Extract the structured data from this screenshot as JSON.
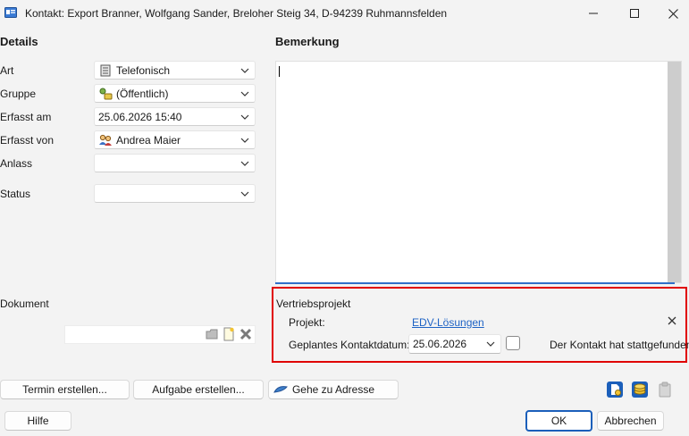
{
  "window": {
    "title": "Kontakt: Export Branner, Wolfgang Sander, Breloher Steig 34, D-94239 Ruhmannsfelden"
  },
  "details": {
    "heading": "Details",
    "fields": {
      "art": {
        "label": "Art",
        "value": "Telefonisch",
        "icon": "phone-list-icon"
      },
      "gruppe": {
        "label": "Gruppe",
        "value": "(Öffentlich)",
        "icon": "group-key-icon"
      },
      "erfasst_am": {
        "label": "Erfasst am",
        "value": "25.06.2026 15:40"
      },
      "erfasst_von": {
        "label": "Erfasst von",
        "value": "Andrea Maier",
        "icon": "users-icon"
      },
      "anlass": {
        "label": "Anlass",
        "value": ""
      },
      "status": {
        "label": "Status",
        "value": ""
      }
    },
    "dokument": {
      "label": "Dokument",
      "value": ""
    }
  },
  "bemerkung": {
    "heading": "Bemerkung",
    "value": ""
  },
  "vertriebsprojekt": {
    "heading": "Vertriebsprojekt",
    "projekt_label": "Projekt:",
    "projekt_value": "EDV-Lösungen",
    "datum_label": "Geplantes Kontaktdatum:",
    "datum_value": "25.06.2026",
    "checkbox_label": "Der Kontakt hat stattgefunden",
    "checkbox_checked": false
  },
  "actions": {
    "termin": "Termin erstellen...",
    "aufgabe": "Aufgabe erstellen...",
    "adresse": "Gehe zu Adresse"
  },
  "footer": {
    "hilfe": "Hilfe",
    "ok": "OK",
    "abbrechen": "Abbrechen"
  },
  "colors": {
    "accent": "#1b5fba",
    "link": "#1e63c5",
    "highlight": "#e00000"
  }
}
